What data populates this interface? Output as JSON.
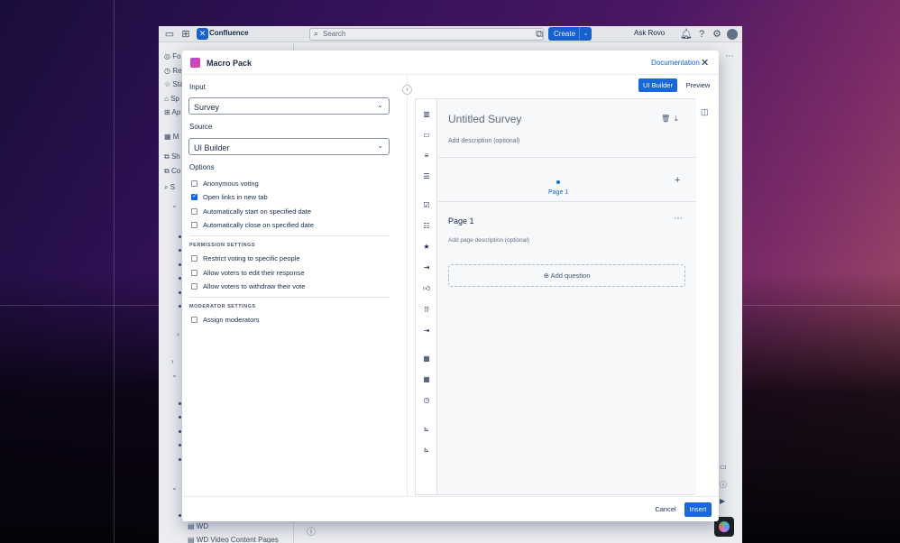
{
  "topbar": {
    "app_name": "Confluence",
    "search_placeholder": "Search",
    "create_label": "Create",
    "ask_rovo_label": "Ask Rovo"
  },
  "sidebar": {
    "top_items": [
      "Fo",
      "Re",
      "Sta",
      "Sp",
      "Ap"
    ],
    "space_short": "M",
    "links": [
      "Sh",
      "Co"
    ],
    "search_short": "S",
    "bottom_pages": [
      "WD",
      "WD Video Content Pages"
    ]
  },
  "modal": {
    "title": "Macro Pack",
    "documentation_link": "Documentation",
    "input_label": "Input",
    "input_value": "Survey",
    "source_label": "Source",
    "source_value": "UI Builder",
    "options_label": "Options",
    "options": [
      {
        "label": "Anonymous voting",
        "checked": false
      },
      {
        "label": "Open links in new tab",
        "checked": true
      },
      {
        "label": "Automatically start on specified date",
        "checked": false
      },
      {
        "label": "Automatically close on specified date",
        "checked": false
      }
    ],
    "permission_title": "PERMISSION SETTINGS",
    "permissions": [
      {
        "label": "Restrict voting to specific people",
        "checked": false
      },
      {
        "label": "Allow voters to edit their response",
        "checked": false
      },
      {
        "label": "Allow voters to withdraw their vote",
        "checked": false
      }
    ],
    "moderator_title": "MODERATOR SETTINGS",
    "moderators": [
      {
        "label": "Assign moderators",
        "checked": false
      }
    ],
    "tabs": {
      "ui_builder": "UI Builder",
      "preview": "Preview"
    },
    "builder": {
      "title_placeholder": "Untitled Survey",
      "description_placeholder": "Add description (optional)",
      "page_tab_label": "Page 1",
      "page_heading": "Page 1",
      "page_description_placeholder": "Add page description (optional)",
      "add_question_label": "Add question",
      "tools": [
        "bar-chart-icon",
        "folder-icon",
        "text-lines-icon",
        "list-icon",
        "checklist-icon",
        "multi-checklist-icon",
        "star-icon",
        "indent-icon",
        "thumbs-up-icon",
        "grip-icon",
        "indent-alt-icon",
        "calendar-icon",
        "calendar-alt-icon",
        "clock-icon",
        "scale-icon",
        "scale-alt-icon"
      ]
    },
    "cancel_label": "Cancel",
    "insert_label": "Insert"
  },
  "colors": {
    "primary": "#1868db",
    "link": "#0c66e4",
    "text": "#172b4d"
  }
}
